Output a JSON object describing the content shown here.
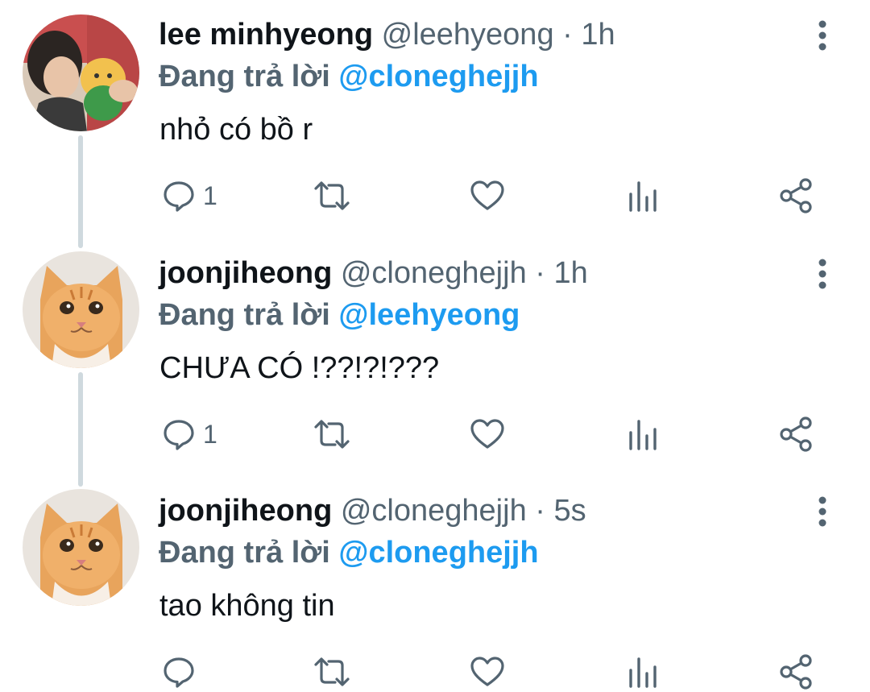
{
  "tweets": [
    {
      "name": "lee minhyeong",
      "handle": "@leehyeong",
      "separator": "·",
      "time": "1h",
      "reply_prefix": "Đang trả lời",
      "reply_to": "@cloneghejjh",
      "text": "nhỏ có bồ r",
      "reply_count": "1",
      "avatar": "person-with-plush-avatar"
    },
    {
      "name": "joonjiheong",
      "handle": "@cloneghejjh",
      "separator": "·",
      "time": "1h",
      "reply_prefix": "Đang trả lời",
      "reply_to": "@leehyeong",
      "text": "CHƯA CÓ !??!?!???",
      "reply_count": "1",
      "avatar": "orange-cat-avatar"
    },
    {
      "name": "joonjiheong",
      "handle": "@cloneghejjh",
      "separator": "·",
      "time": "5s",
      "reply_prefix": "Đang trả lời",
      "reply_to": "@cloneghejjh",
      "text": "tao không tin",
      "reply_count": "",
      "avatar": "orange-cat-avatar"
    }
  ],
  "icons": {
    "reply": "comment-icon",
    "retweet": "retweet-icon",
    "like": "heart-icon",
    "views": "analytics-icon",
    "share": "share-icon",
    "more": "more-vertical-icon"
  },
  "colors": {
    "text": "#0f1419",
    "secondary": "#536471",
    "mention": "#1d9bf0",
    "thread_line": "#cfd9de"
  }
}
